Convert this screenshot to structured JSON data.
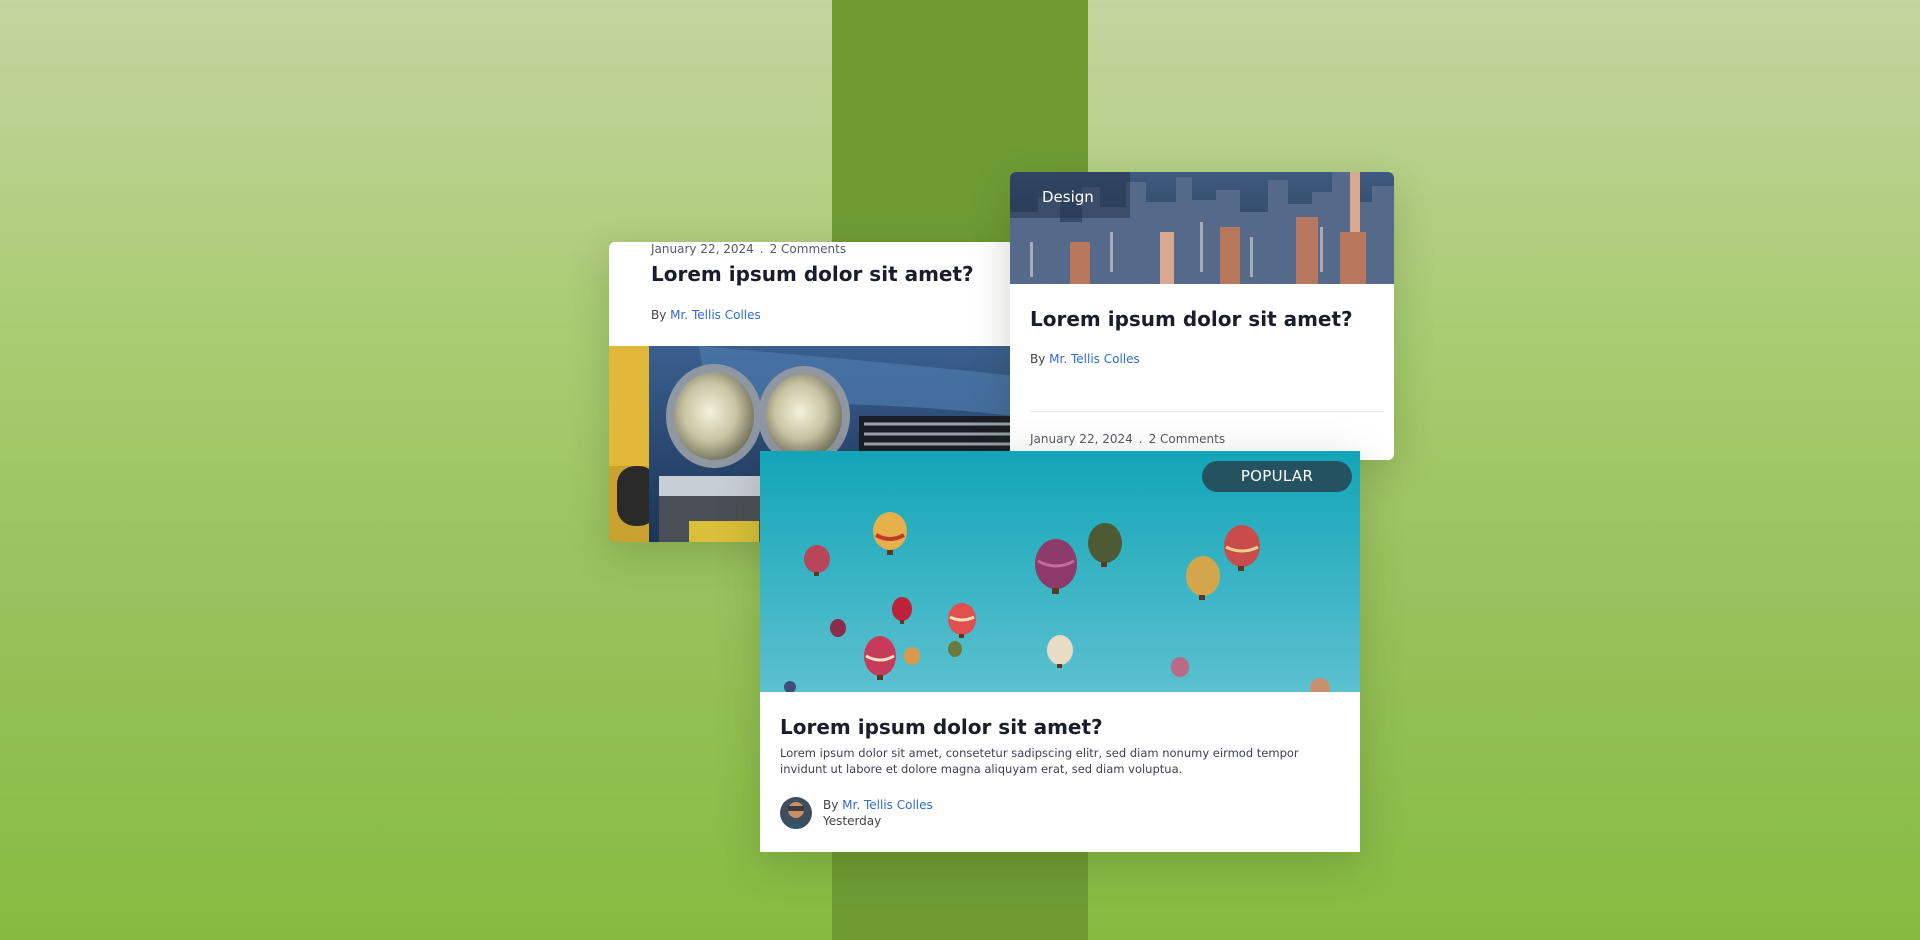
{
  "cards": [
    {
      "date": "January 22, 2024",
      "separator": ".",
      "comments": "2 Comments",
      "title": "Lorem ipsum dolor sit amet?",
      "by": "By",
      "author": "Mr. Tellis Colles",
      "image": "vintage-car-headlights-photo"
    },
    {
      "tag": "Design",
      "title": "Lorem ipsum dolor sit amet?",
      "by": "By",
      "author": "Mr. Tellis Colles",
      "date": "January 22, 2024",
      "separator": ".",
      "comments": "2 Comments",
      "image": "city-skyline-aerial-photo"
    },
    {
      "badge": "POPULAR",
      "title": "Lorem ipsum dolor sit amet?",
      "excerpt": "Lorem ipsum dolor sit amet, consetetur sadipscing elitr, sed diam nonumy eirmod tempor invidunt ut labore et dolore magna aliquyam erat, sed diam voluptua.",
      "by": "By",
      "author": "Mr. Tellis Colles",
      "time": "Yesterday",
      "image": "hot-air-balloons-photo",
      "avatar": "author-avatar"
    }
  ],
  "colors": {
    "background_top": "#c5d4a0",
    "background_bottom": "#86bb40",
    "center_stripe": "#6e9c33",
    "badge": "#255260",
    "link": "#2f6cd1",
    "title": "#1a1d2b"
  }
}
